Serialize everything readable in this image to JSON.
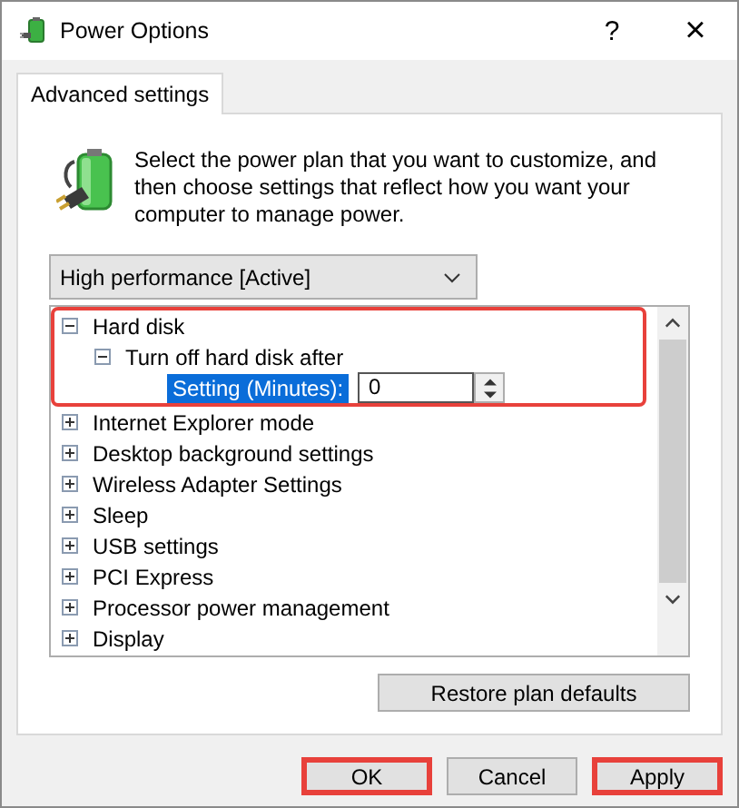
{
  "window": {
    "title": "Power Options",
    "help": "?",
    "close": "×"
  },
  "tabs": [
    {
      "label": "Advanced settings",
      "selected": true
    }
  ],
  "intro": "Select the power plan that you want to customize, and then choose settings that reflect how you want your computer to manage power.",
  "plan_dropdown": {
    "value": "High performance [Active]"
  },
  "tree": [
    {
      "kind": "group",
      "label": "Hard disk",
      "expanded": true,
      "highlighted": true,
      "children": [
        {
          "kind": "group",
          "label": "Turn off hard disk after",
          "expanded": true,
          "children": [
            {
              "kind": "setting",
              "label": "Setting (Minutes):",
              "value": "0",
              "selected": true
            }
          ]
        }
      ]
    },
    {
      "kind": "group",
      "label": "Internet Explorer mode",
      "expanded": false,
      "highlighted": false
    },
    {
      "kind": "group",
      "label": "Desktop background settings",
      "expanded": false,
      "highlighted": false
    },
    {
      "kind": "group",
      "label": "Wireless Adapter Settings",
      "expanded": false,
      "highlighted": false
    },
    {
      "kind": "group",
      "label": "Sleep",
      "expanded": false,
      "highlighted": false
    },
    {
      "kind": "group",
      "label": "USB settings",
      "expanded": false,
      "highlighted": false
    },
    {
      "kind": "group",
      "label": "PCI Express",
      "expanded": false,
      "highlighted": false
    },
    {
      "kind": "group",
      "label": "Processor power management",
      "expanded": false,
      "highlighted": false
    },
    {
      "kind": "group",
      "label": "Display",
      "expanded": false,
      "highlighted": false
    }
  ],
  "restore_button": "Restore plan defaults",
  "buttons": [
    {
      "label": "OK",
      "highlighted": true
    },
    {
      "label": "Cancel",
      "highlighted": false
    },
    {
      "label": "Apply",
      "highlighted": true
    }
  ]
}
